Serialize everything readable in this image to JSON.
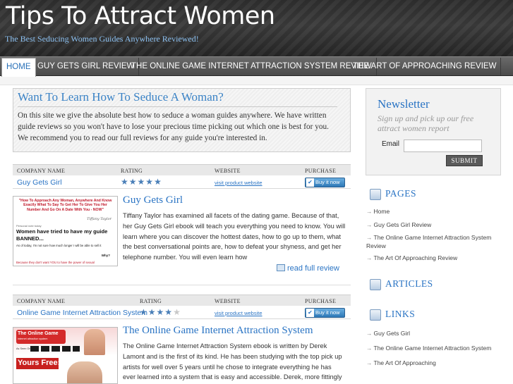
{
  "site": {
    "title": "Tips To Attract Women",
    "tagline": "The Best Seducing Women Guides Anywhere Reviewed!"
  },
  "nav": {
    "items": [
      {
        "label": "HOME",
        "active": true
      },
      {
        "label": "GUY GETS GIRL REVIEW"
      },
      {
        "label": "THE ONLINE GAME INTERNET ATTRACTION SYSTEM REVIEW"
      },
      {
        "label": "THE ART OF APPROACHING REVIEW"
      }
    ]
  },
  "welcome": {
    "title": "Want To Learn How To Seduce A Woman?",
    "text": "On this site we give the absolute best how to seduce a woman guides anywhere. We have written guide reviews so you won't have to lose your precious time picking out which one is best for you. We recommend you to read our full reviews for any guide you're interested in."
  },
  "table_headers": {
    "company": "COMPANY NAME",
    "rating": "RATING",
    "website": "WEBSITE",
    "purchase": "PURCHASE"
  },
  "products": [
    {
      "company": "Guy Gets Girl",
      "rating": 5,
      "rating_max": 5,
      "website_link": "visit product website",
      "buy_label": "Buy it now",
      "title": "Guy Gets Girl",
      "description": "Tiffany Taylor has examined all facets of the dating game. Because of that, her Guy Gets Girl ebook will teach you everything you need to know. You will learn where you can discover the hottest dates, how to go up to them, what the best conversational points are, how to defeat your shyness, and get her telephone number. You will even learn how",
      "read_more": "read full review",
      "thumb": {
        "headline": "\"How To Approach Any Woman, Anywhere And Know Exactly What To Say To Get Her To Give You Her Number And Go On A Date With You - NOW\"",
        "signature": "Tiffany Taylor",
        "small_line": "Personal note today",
        "big_line": "Women have tried to have my guide BANNED...",
        "note": "As of today, I'm not sure how much longer I will be able to sell it",
        "why": "Why?",
        "footer": "Because they don't want YOU to have the power of sexual"
      }
    },
    {
      "company": "Online Game Internet Attraction System",
      "rating": 4,
      "rating_max": 5,
      "website_link": "visit product website",
      "buy_label": "Buy it now",
      "title": "The Online Game Internet Attraction System",
      "description": "The Online Game Internet Attraction System ebook is written by Derek Lamont and is the first of its kind. He has been studying with the top pick up artists for well over 5 years until he chose to integrate everything he has ever learned into a system that is easy and accessible. Derek, more fittingly dubbed Derek for his world online",
      "thumb": {
        "logo": "The Online Game",
        "logo_sub": "internet attraction system",
        "as_seen": "As Seen On",
        "promo": "Yours Free:"
      }
    }
  ],
  "newsletter": {
    "title": "Newsletter",
    "subtitle": "Sign up and pick up our free attract women report",
    "email_label": "Email",
    "email_value": "",
    "submit_label": "SUBMIT"
  },
  "sidebar": {
    "pages_title": "PAGES",
    "pages": [
      "Home",
      "Guy Gets Girl Review",
      "The Online Game Internet Attraction System Review",
      "The Art Of Approaching Review"
    ],
    "articles_title": "ARTICLES",
    "links_title": "LINKS",
    "links": [
      "Guy Gets Girl",
      "The Online Game Internet Attraction System",
      "The Art Of Approaching"
    ]
  },
  "colors": {
    "link": "#2a74c4",
    "header_bg": "#333333",
    "nav_bg": "#5a5a5a",
    "tagline": "#8cc0f0"
  }
}
